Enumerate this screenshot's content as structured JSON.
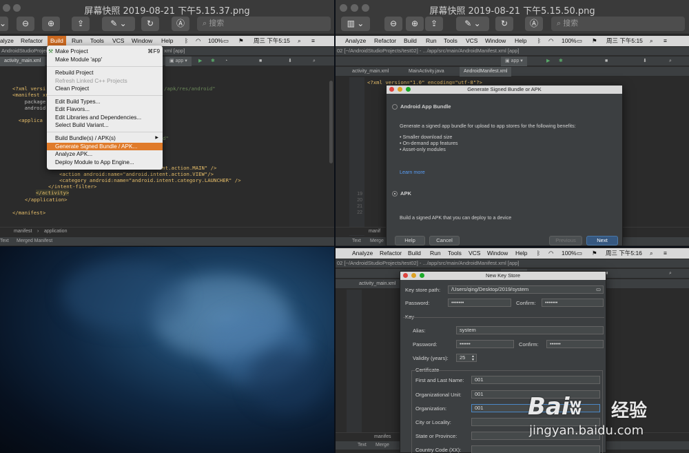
{
  "left_window": {
    "title": "屏幕快照 2019-08-21 下午5.15.37.png",
    "search_placeholder": "搜索",
    "menubar": [
      "alyze",
      "Refactor",
      "Build",
      "Run",
      "Tools",
      "VCS",
      "Window",
      "Help"
    ],
    "status_right": "100%",
    "clock": "周三 下午5:15",
    "path": "AndroidStudioProjec",
    "path_tail": "xml [app]",
    "tab_file": "activity_main.xml",
    "run_config": "app",
    "build_menu": {
      "items": [
        {
          "label": "Make Project",
          "shortcut": "⌘F9",
          "disabled": false
        },
        {
          "label": "Make Module 'app'",
          "disabled": false
        },
        {
          "label": "Rebuild Project",
          "disabled": false
        },
        {
          "label": "Refresh Linked C++ Projects",
          "disabled": true
        },
        {
          "label": "Clean Project",
          "disabled": false
        },
        {
          "label": "Edit Build Types...",
          "disabled": false
        },
        {
          "label": "Edit Flavors...",
          "disabled": false
        },
        {
          "label": "Edit Libraries and Dependencies...",
          "disabled": false
        },
        {
          "label": "Select Build Variant...",
          "disabled": false
        },
        {
          "label": "Build Bundle(s) / APK(s)",
          "disabled": false,
          "submenu": "▶"
        },
        {
          "label": "Generate Signed Bundle / APK...",
          "disabled": false,
          "selected": true
        },
        {
          "label": "Analyze APK...",
          "disabled": false
        },
        {
          "label": "Deploy Module to App Engine...",
          "disabled": false
        }
      ]
    },
    "code": {
      "l1": "<?xml versi",
      "l2": "<manifest xn",
      "l3": "    package",
      "l4": "    android",
      "l5": "<applica",
      "res": "/apk/res/android\"",
      "d": "d\"",
      "action_main": "<action android:name=\"android.intent.action.MAIN\" />",
      "action_view": "<action android:name=\"android.intent.action.VIEW\"/>",
      "category": "<category android:name=\"android.intent.category.LAUNCHER\" />",
      "end_filter": "</intent-filter>",
      "end_activity": "</activity>",
      "end_app": "</application>",
      "end_manifest": "</manifest>"
    },
    "breadcrumb": [
      "manifest",
      "application"
    ],
    "bottom_tabs": [
      "Text",
      "Merged Manifest"
    ]
  },
  "right_top_window": {
    "title": "屏幕快照 2019-08-21 下午5.15.50.png",
    "search_placeholder": "搜索",
    "menubar": [
      "Analyze",
      "Refactor",
      "Build",
      "Run",
      "Tools",
      "VCS",
      "Window",
      "Help"
    ],
    "status_right": "100%",
    "clock": "周三 下午5:15",
    "path": "02 [~/AndroidStudioProjects/test02] - .../app/src/main/AndroidManifest.xml [app]",
    "tabs": [
      "activity_main.xml",
      "MainActivity.java",
      "AndroidManifest.xml"
    ],
    "run_config": "app",
    "code_line1": "<?xml version=\"1.0\" encoding=\"utf-8\"?>",
    "dialog": {
      "title": "Generate Signed Bundle or APK",
      "option_bundle": "Android App Bundle",
      "bundle_desc": "Generate a signed app bundle for upload to app stores for the following benefits:",
      "benefits": [
        "Smaller download size",
        "On-demand app features",
        "Asset-only modules"
      ],
      "learn_more": "Learn more",
      "option_apk": "APK",
      "apk_desc": "Build a signed APK that you can deploy to a device",
      "help": "Help",
      "cancel": "Cancel",
      "previous": "Previous",
      "next": "Next"
    },
    "bottom_tabs": [
      "Text",
      "Merge"
    ],
    "breadcrumb": "manif"
  },
  "right_bottom_window": {
    "menubar": [
      "Analyze",
      "Refactor",
      "Build",
      "Run",
      "Tools",
      "VCS",
      "Window",
      "Help"
    ],
    "status_right": "100%",
    "clock": "周三 下午5:16",
    "path": "02 [~/AndroidStudioProjects/test02] - .../app/src/main/AndroidManifest.xml [app]",
    "tab_file": "activity_main.xml",
    "run_config": "app",
    "dialog": {
      "title": "New Key Store",
      "key_store_path_label": "Key store path:",
      "key_store_path": "/Users/qing/Desktop/2019/system",
      "password_label": "Password:",
      "password": "•••••••",
      "confirm_label": "Confirm:",
      "confirm": "•••••••",
      "key_section": "Key",
      "alias_label": "Alias:",
      "alias": "system",
      "key_password_label": "Password:",
      "key_password": "••••••",
      "key_confirm_label": "Confirm:",
      "key_confirm": "••••••",
      "validity_label": "Validity (years):",
      "validity": "25",
      "cert_section": "Certificate",
      "first_last_label": "First and Last Name:",
      "first_last": "001",
      "org_unit_label": "Organizational Unit:",
      "org_unit": "001",
      "org_label": "Organization:",
      "org": "001",
      "city_label": "City or Locality:",
      "state_label": "State or Province:",
      "country_label": "Country Code (XX):"
    },
    "bottom_tabs": [
      "Text",
      "Merge"
    ],
    "breadcrumb": "manifes"
  },
  "watermark": {
    "brand": "Bai",
    "brand_cn": "经验",
    "url": "jingyan.baidu.com"
  }
}
